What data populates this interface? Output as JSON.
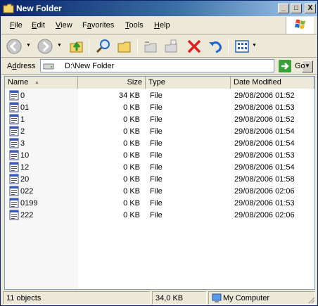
{
  "window": {
    "title": "New Folder",
    "controls": {
      "minimize": "_",
      "maximize": "□",
      "close": "X"
    }
  },
  "menu": {
    "items": [
      {
        "label": "File",
        "key": "F",
        "rest": "ile"
      },
      {
        "label": "Edit",
        "key": "E",
        "rest": "dit"
      },
      {
        "label": "View",
        "key": "V",
        "rest": "iew"
      },
      {
        "label": "Favorites",
        "key": "a",
        "pre": "F",
        "rest": "vorites"
      },
      {
        "label": "Tools",
        "key": "T",
        "rest": "ools"
      },
      {
        "label": "Help",
        "key": "H",
        "rest": "elp"
      }
    ]
  },
  "toolbar": {
    "icons": [
      "back-icon",
      "forward-icon",
      "up-folder-icon",
      "search-icon",
      "folders-icon",
      "move-to-icon",
      "copy-to-icon",
      "delete-icon",
      "undo-icon",
      "views-icon"
    ]
  },
  "address": {
    "label": "Address",
    "label_key": "d",
    "value": "D:\\New Folder",
    "go_label": "Go"
  },
  "list": {
    "columns": [
      "Name",
      "Size",
      "Type",
      "Date Modified"
    ],
    "sort_column": "Name",
    "rows": [
      {
        "name": "0",
        "size": "34 KB",
        "type": "File",
        "date": "29/08/2006 01:52"
      },
      {
        "name": "01",
        "size": "0 KB",
        "type": "File",
        "date": "29/08/2006 01:53"
      },
      {
        "name": "1",
        "size": "0 KB",
        "type": "File",
        "date": "29/08/2006 01:52"
      },
      {
        "name": "2",
        "size": "0 KB",
        "type": "File",
        "date": "29/08/2006 01:54"
      },
      {
        "name": "3",
        "size": "0 KB",
        "type": "File",
        "date": "29/08/2006 01:54"
      },
      {
        "name": "10",
        "size": "0 KB",
        "type": "File",
        "date": "29/08/2006 01:53"
      },
      {
        "name": "12",
        "size": "0 KB",
        "type": "File",
        "date": "29/08/2006 01:54"
      },
      {
        "name": "20",
        "size": "0 KB",
        "type": "File",
        "date": "29/08/2006 01:58"
      },
      {
        "name": "022",
        "size": "0 KB",
        "type": "File",
        "date": "29/08/2006 02:06"
      },
      {
        "name": "0199",
        "size": "0 KB",
        "type": "File",
        "date": "29/08/2006 01:53"
      },
      {
        "name": "222",
        "size": "0 KB",
        "type": "File",
        "date": "29/08/2006 02:06"
      }
    ]
  },
  "status": {
    "objects": "11 objects",
    "size": "34,0 KB",
    "location": "My Computer"
  }
}
